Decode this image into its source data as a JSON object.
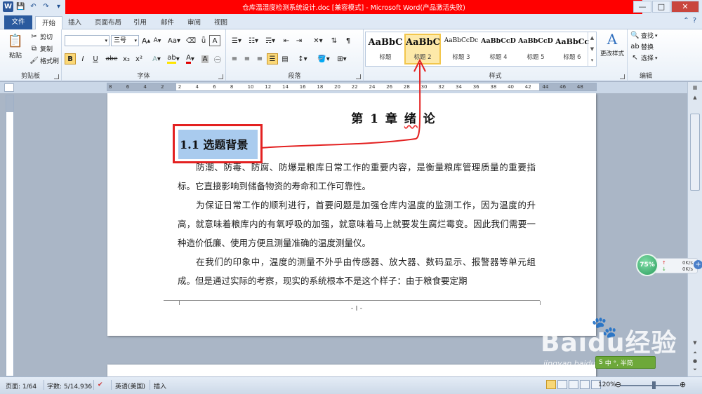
{
  "window": {
    "title": "仓库温湿度检测系统设计.doc [兼容模式] - Microsoft Word(产品激活失败)",
    "minimize": "—",
    "maximize": "□",
    "close": "✕"
  },
  "tabs": [
    {
      "label": "文件"
    },
    {
      "label": "开始"
    },
    {
      "label": "插入"
    },
    {
      "label": "页面布局"
    },
    {
      "label": "引用"
    },
    {
      "label": "邮件"
    },
    {
      "label": "审阅"
    },
    {
      "label": "视图"
    }
  ],
  "clipboard": {
    "paste": "粘贴",
    "cut": "剪切",
    "copy": "复制",
    "format_painter": "格式刷",
    "group": "剪贴板"
  },
  "font": {
    "family": "",
    "size": "三号",
    "grow": "A",
    "shrink": "A",
    "change_case": "Aa",
    "clear": "A",
    "bold": "B",
    "italic": "I",
    "underline": "U",
    "strike": "abe",
    "subscript": "x₂",
    "superscript": "x²",
    "group": "字体"
  },
  "paragraph": {
    "group": "段落"
  },
  "styles": {
    "group": "样式",
    "items": [
      {
        "sample": "AaBbC",
        "name": "标题"
      },
      {
        "sample": "AaBbC",
        "name": "标题 2"
      },
      {
        "sample": "AaBbCcDc",
        "name": "标题 3"
      },
      {
        "sample": "AaBbCcD",
        "name": "标题 4"
      },
      {
        "sample": "AaBbCcD",
        "name": "标题 5"
      },
      {
        "sample": "AaBbCc",
        "name": "标题 6"
      }
    ],
    "change_styles": "更改样式"
  },
  "editing": {
    "find": "查找",
    "replace": "替换",
    "select": "选择",
    "group": "编辑"
  },
  "ruler": {
    "numbers": [
      "8",
      "6",
      "4",
      "2",
      "2",
      "4",
      "6",
      "8",
      "10",
      "12",
      "14",
      "16",
      "18",
      "20",
      "22",
      "24",
      "26",
      "28",
      "30",
      "32",
      "34",
      "36",
      "38",
      "40",
      "42",
      "44",
      "46",
      "48"
    ]
  },
  "document": {
    "chapter_prefix": "第 1 章  ",
    "chapter_squiggle": "绪",
    "chapter_suffix": "  论",
    "heading": "1.1 选题背景",
    "paragraphs": [
      "　　防潮、防毒、防腐、防爆是粮库日常工作的重要内容，是衡量粮库管理质量的重要指标。它直接影响到储备物资的寿命和工作可靠性。",
      "　　为保证日常工作的顺利进行，首要问题是加强仓库内温度的监测工作，因为温度的升高，就意味着粮库内的有氧呼吸的加强，就意味着马上就要发生腐烂霉变。因此我们需要一种造价低廉、使用方便且测量准确的温度测量仪。",
      "　　在我们的印象中，温度的测量不外乎由传感器、放大器、数码显示、报警器等单元组成。但是通过实际的考察，现实的系统根本不是这个样子：由于粮食要定期"
    ],
    "page_number": "- I -"
  },
  "network": {
    "percent": "75%",
    "up": "0K/s",
    "down": "0K/s",
    "plus": "+"
  },
  "watermark": {
    "logo": "Baidu经验",
    "site": "jingyan.baidu.com"
  },
  "ime": {
    "text": "中 °, 半简"
  },
  "status": {
    "page": "页面: 1/64",
    "words": "字数: 5/14,936",
    "language": "英语(美国)",
    "mode": "插入",
    "zoom": "120%"
  },
  "colors": {
    "title_bar_red": "#ff0000",
    "annotation_red": "#e32121",
    "heading_highlight": "#a9cbee",
    "file_tab": "#2a5a9e"
  }
}
